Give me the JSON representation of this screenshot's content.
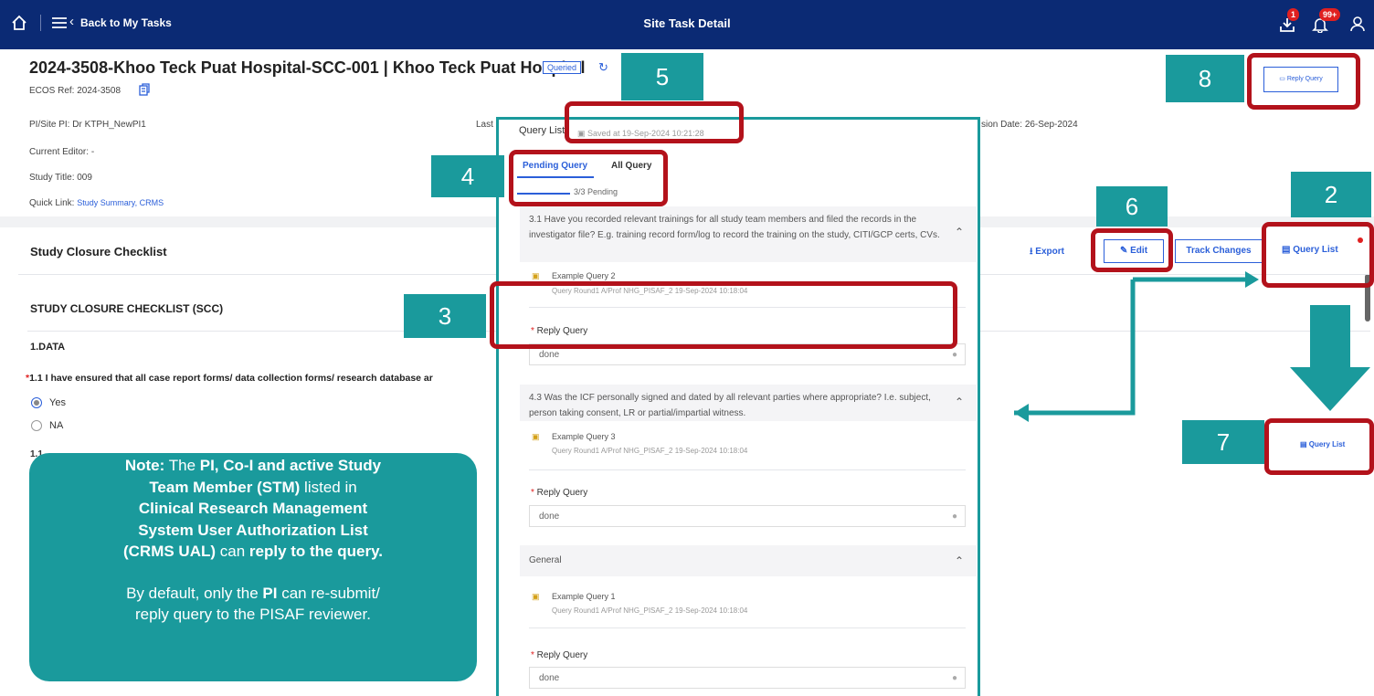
{
  "topbar": {
    "back_label": "Back to My Tasks",
    "title": "Site Task Detail",
    "download_badge": "1",
    "notification_badge": "99+"
  },
  "header": {
    "title": "2024-3508-Khoo Teck Puat Hospital-SCC-001 | Khoo Teck Puat Hospital",
    "status": "Queried",
    "ecos_ref": "ECOS Ref: 2024-3508",
    "reply_query_label": "Reply Query"
  },
  "info": {
    "pi_label": "PI/Site PI:",
    "pi_value": "Dr KTPH_NewPI1",
    "last_label": "Last",
    "submission_label": "sion Date:",
    "submission_value": "26-Sep-2024",
    "editor_label": "Current Editor:",
    "editor_value": "-",
    "study_title_label": "Study Title:",
    "study_title_value": "009",
    "quick_link_label": "Quick Link:",
    "quick_link_value": "Study Summary, CRMS"
  },
  "checklist_bar": {
    "title": "Study Closure Checklist",
    "export": "Export",
    "edit": "Edit",
    "track_changes": "Track Changes",
    "query_list": "Query List"
  },
  "form": {
    "heading": "STUDY CLOSURE CHECKLIST (SCC)",
    "section": "1.DATA",
    "q1": "1.1 I have ensured that all case report forms/ data collection forms/ research database ar",
    "opt_yes": "Yes",
    "opt_na": "NA",
    "q2_partial": "1.1"
  },
  "panel": {
    "title": "Query List",
    "saved": "Saved at 19-Sep-2024 10:21:28",
    "tab_pending": "Pending Query",
    "tab_all": "All Query",
    "pending_count": "3/3 Pending",
    "groups": [
      {
        "question": "3.1 Have you recorded relevant trainings for all study team members and filed the records in the investigator file? E.g. training record form/log to record the training on the study, CITI/GCP certs, CVs.",
        "query_name": "Example Query 2",
        "query_meta": "Query Round1   A/Prof NHG_PISAF_2   19-Sep-2024 10:18:04",
        "reply_label": "Reply Query",
        "reply_value": "done"
      },
      {
        "question": "4.3 Was the ICF personally signed and dated by all relevant parties where appropriate? I.e. subject, person taking consent, LR or partial/impartial witness.",
        "query_name": "Example Query 3",
        "query_meta": "Query Round1   A/Prof NHG_PISAF_2   19-Sep-2024 10:18:04",
        "reply_label": "Reply Query",
        "reply_value": "done"
      },
      {
        "question": "General",
        "query_name": "Example Query 1",
        "query_meta": "Query Round1   A/Prof NHG_PISAF_2   19-Sep-2024 10:18:04",
        "reply_label": "Reply Query",
        "reply_value": "done"
      }
    ]
  },
  "callouts": [
    "2",
    "3",
    "4",
    "5",
    "6",
    "7",
    "8"
  ],
  "note": {
    "l1a": "Note:",
    "l1b": " The ",
    "l1c": "PI, Co-I and active Study",
    "l2a": "Team Member (STM)",
    "l2b": " listed in",
    "l3": "Clinical Research Management",
    "l4": "System User Authorization List",
    "l5a": "(CRMS UAL)",
    "l5b": " can ",
    "l5c": "reply to the query.",
    "l6a": "By default, only the ",
    "l6b": "PI",
    "l6c": " can re-submit/",
    "l7": "reply query to the PISAF reviewer."
  },
  "colors": {
    "nav": "#0b2a74",
    "accent": "#2b5fd9",
    "callout": "#1a9a9c",
    "highlight": "#b3121b"
  }
}
